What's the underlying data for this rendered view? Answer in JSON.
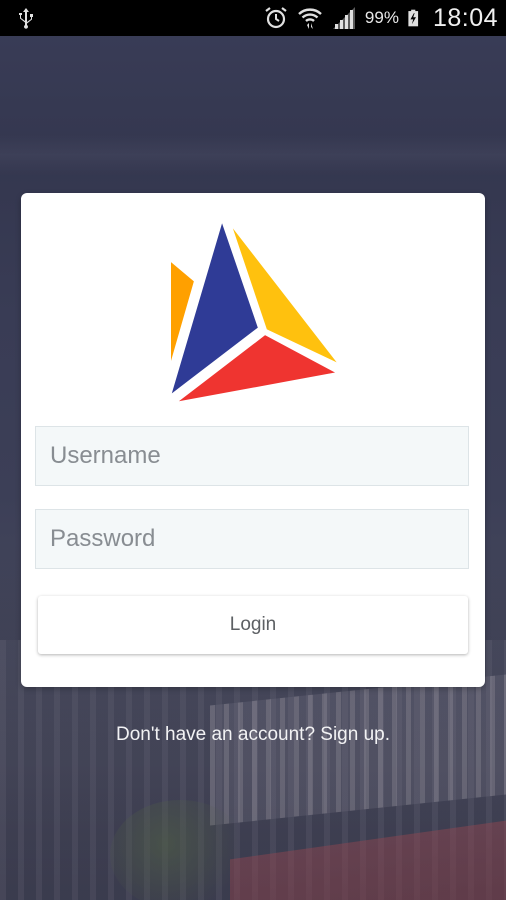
{
  "status_bar": {
    "usb_icon": "usb-icon",
    "alarm_icon": "alarm-icon",
    "wifi_icon": "wifi-icon",
    "signal_icon": "signal-icon",
    "battery_icon": "battery-charging-icon",
    "battery_percent": "99%",
    "time": "18:04"
  },
  "login": {
    "logo_icon": "triangle-logo-icon",
    "logo_colors": {
      "navy": "#2f3b96",
      "yellow": "#ffc10e",
      "red": "#ef3430",
      "orange": "#ffa000"
    },
    "username_placeholder": "Username",
    "password_placeholder": "Password",
    "login_label": "Login"
  },
  "footer": {
    "signup_text": "Don't have an account? Sign up."
  }
}
